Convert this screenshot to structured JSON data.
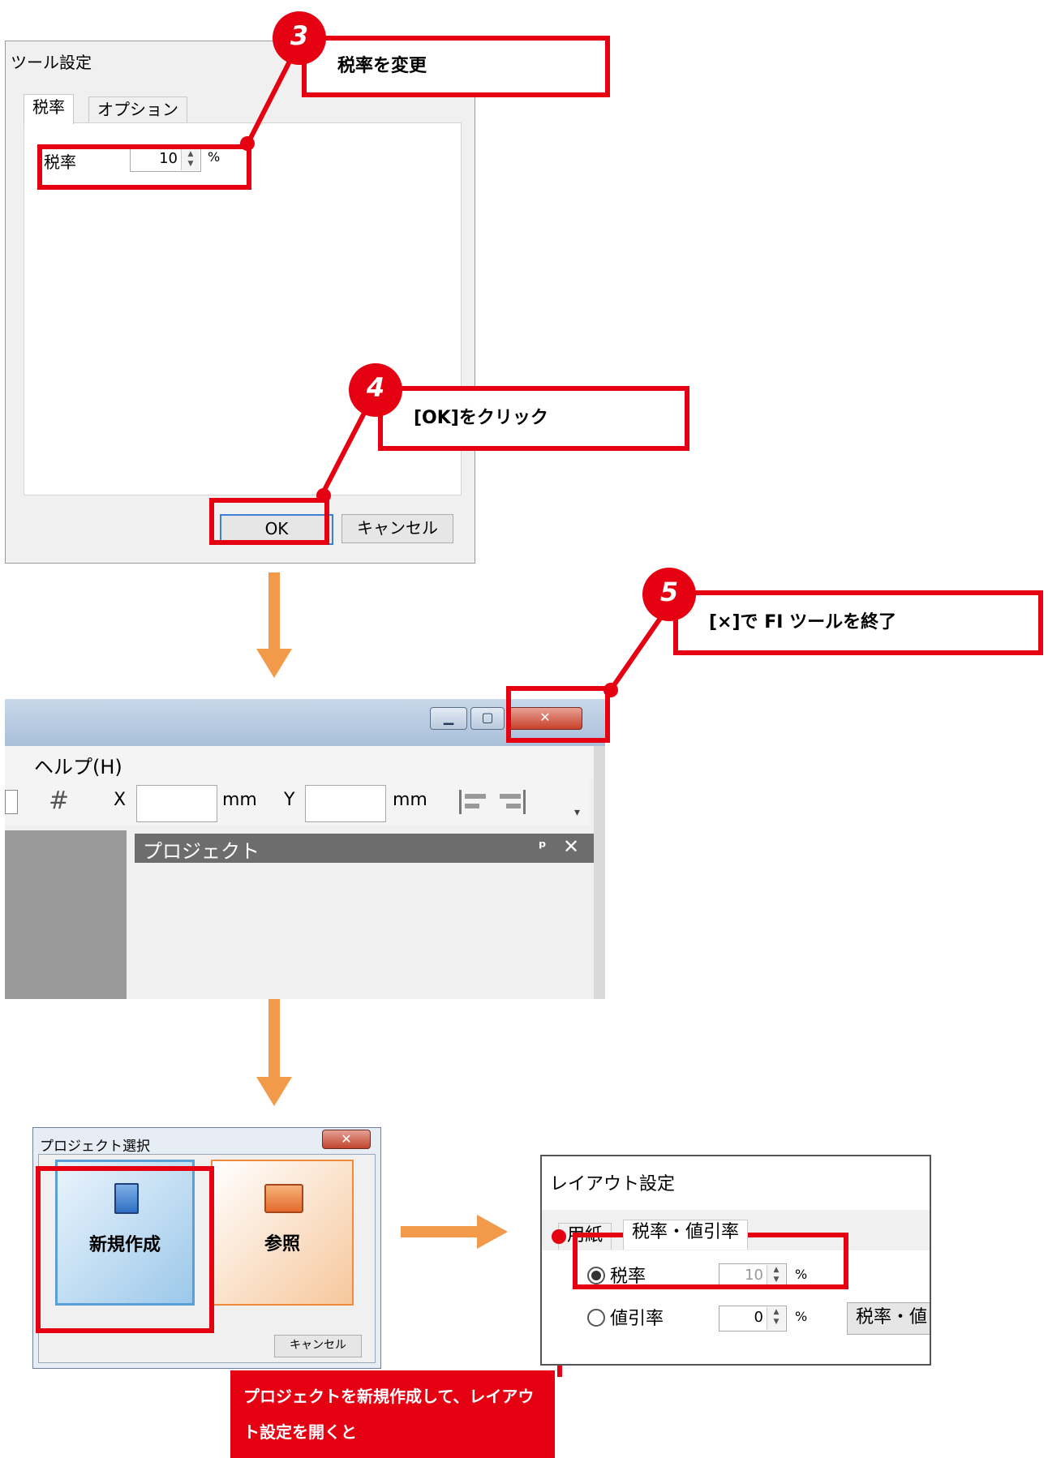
{
  "tool_dialog": {
    "title": "ツール設定",
    "tabs": [
      "税率",
      "オプション"
    ],
    "tax_label": "税率",
    "tax_value": "10",
    "tax_unit": "%",
    "ok_label": "OK",
    "cancel_label": "キャンセル"
  },
  "callouts": {
    "step3": {
      "number": "3",
      "text": "税率を変更"
    },
    "step4": {
      "number": "4",
      "text": "[OK]をクリック"
    },
    "step5": {
      "number": "5",
      "text": "[×]で FI ツールを終了"
    },
    "note": "プロジェクトを新規作成して、レイアウト設定を開くと"
  },
  "app_window": {
    "menu_help": "ヘルプ(H)",
    "toolbar": {
      "x_label": "X",
      "x_unit": "mm",
      "y_label": "Y",
      "y_unit": "mm"
    },
    "project_panel_title": "プロジェクト",
    "pin_icon": "pin-icon",
    "close_glyph": "✕"
  },
  "project_dialog": {
    "title": "プロジェクト選択",
    "new_label": "新規作成",
    "browse_label": "参照",
    "cancel_label": "キャンセル"
  },
  "layout_window": {
    "title": "レイアウト設定",
    "tabs": [
      "用紙",
      "税率・値引率"
    ],
    "tax_label": "税率",
    "tax_value": "10",
    "tax_unit": "%",
    "discount_label": "値引率",
    "discount_value": "0",
    "discount_unit": "%",
    "button_partial": "税率・値"
  },
  "colors": {
    "accent_red": "#e50012",
    "arrow_orange": "#f29a4a"
  }
}
